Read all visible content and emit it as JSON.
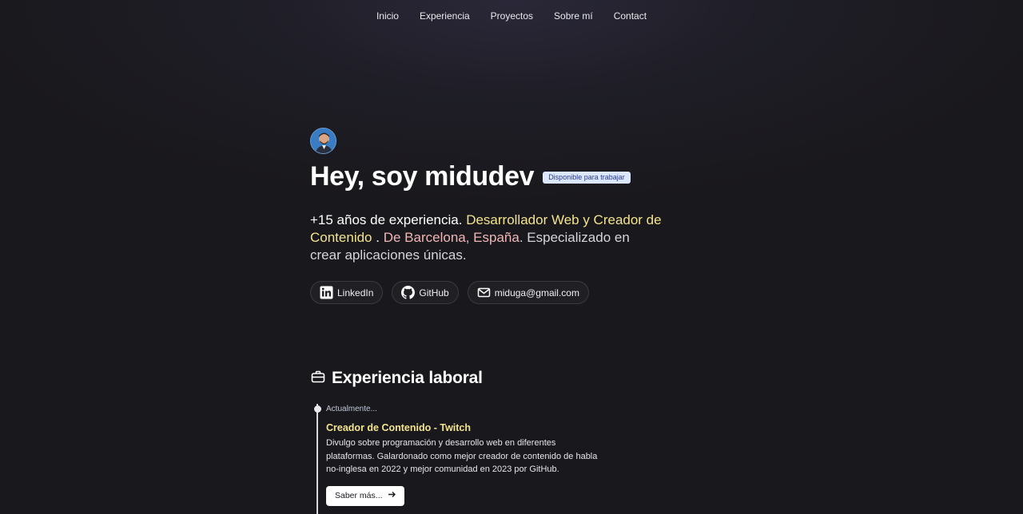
{
  "nav": {
    "items": [
      "Inicio",
      "Experiencia",
      "Proyectos",
      "Sobre mí",
      "Contact"
    ]
  },
  "hero": {
    "avatar_alt": "avatar",
    "title": "Hey, soy midudev",
    "badge": "Disponible para trabajar",
    "intro": {
      "part1": "+15 años de experiencia.",
      "part2": "Desarrollador Web y Creador de Contenido",
      "part3": ".",
      "part4": "De Barcelona, España",
      "part5": ". Especializado en crear aplicaciones únicas."
    },
    "links": [
      {
        "label": "LinkedIn",
        "icon": "linkedin-icon"
      },
      {
        "label": "GitHub",
        "icon": "github-icon"
      },
      {
        "label": "miduga@gmail.com",
        "icon": "mail-icon"
      }
    ]
  },
  "experience": {
    "title": "Experiencia laboral",
    "icon": "briefcase-icon",
    "jobs": [
      {
        "date": "Actualmente...",
        "title": "Creador de Contenido - Twitch",
        "description": "Divulgo sobre programación y desarrollo web en diferentes plataformas. Galardonado como mejor creador de contenido de habla no-inglesa en 2022 y mejor comunidad en 2023 por GitHub.",
        "more_label": "Saber más..."
      }
    ]
  },
  "colors": {
    "background": "#19181c",
    "highlight_yellow": "#f3e48d",
    "highlight_pink": "#f0b7b7",
    "badge_bg": "#dbe6ff"
  }
}
